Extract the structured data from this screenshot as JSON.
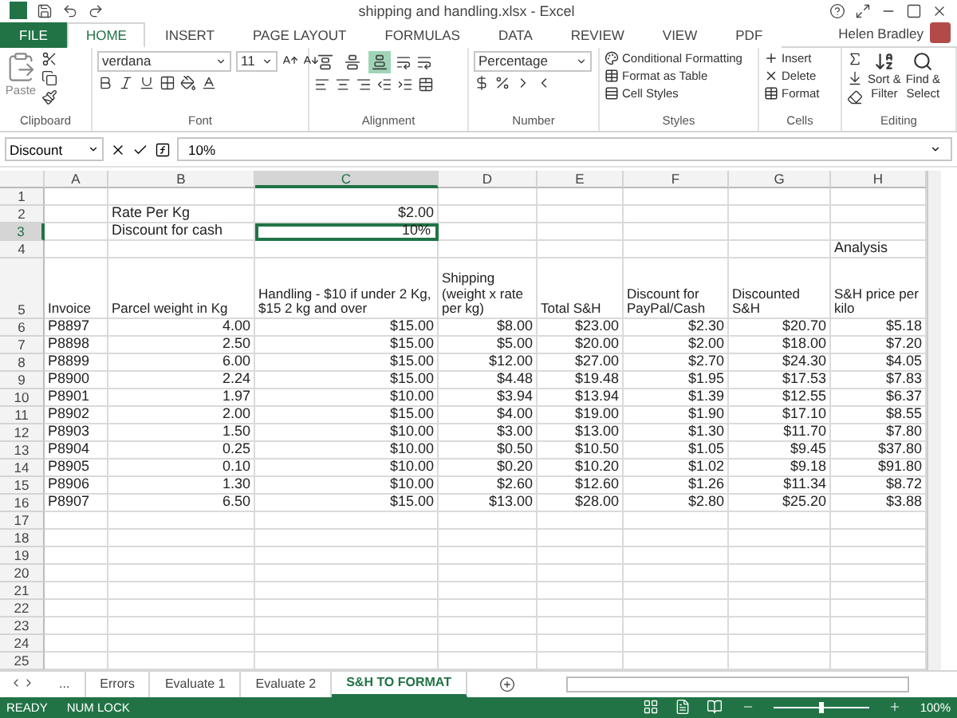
{
  "window": {
    "title": "shipping and handling.xlsx - Excel"
  },
  "ribbon_tabs": [
    {
      "label": "FILE",
      "kind": "file",
      "selected": false
    },
    {
      "label": "HOME",
      "kind": "tab",
      "selected": true
    },
    {
      "label": "INSERT",
      "kind": "tab",
      "selected": false
    },
    {
      "label": "PAGE LAYOUT",
      "kind": "tab",
      "selected": false
    },
    {
      "label": "FORMULAS",
      "kind": "tab",
      "selected": false
    },
    {
      "label": "DATA",
      "kind": "tab",
      "selected": false
    },
    {
      "label": "REVIEW",
      "kind": "tab",
      "selected": false
    },
    {
      "label": "VIEW",
      "kind": "tab",
      "selected": false
    },
    {
      "label": "PDF",
      "kind": "tab",
      "selected": false
    }
  ],
  "user": "Helen Bradley",
  "clipboard": {
    "label": "Clipboard",
    "paste": "Paste"
  },
  "font": {
    "label": "Font",
    "name": "verdana",
    "size": "11"
  },
  "alignment": {
    "label": "Alignment",
    "vertical": [
      {
        "kind": "top",
        "selected": false
      },
      {
        "kind": "middle",
        "selected": false
      },
      {
        "kind": "bottom",
        "selected": true
      }
    ]
  },
  "number": {
    "label": "Number",
    "format": "Percentage"
  },
  "styles": {
    "label": "Styles",
    "items": [
      "Conditional Formatting",
      "Format as Table",
      "Cell Styles"
    ]
  },
  "cells_group": {
    "label": "Cells",
    "items": [
      "Insert",
      "Delete",
      "Format"
    ]
  },
  "editing": {
    "label": "Editing",
    "items": [
      "Sort &",
      "Filter",
      "Find &",
      "Select"
    ]
  },
  "formula_bar": {
    "name_box": "Discount",
    "value": "10%"
  },
  "columns": [
    {
      "label": "A",
      "selected": false
    },
    {
      "label": "B",
      "selected": false
    },
    {
      "label": "C",
      "selected": true
    },
    {
      "label": "D",
      "selected": false
    },
    {
      "label": "E",
      "selected": false
    },
    {
      "label": "F",
      "selected": false
    },
    {
      "label": "G",
      "selected": false
    },
    {
      "label": "H",
      "selected": false
    }
  ],
  "rows": [
    {
      "header": "1",
      "selected": false,
      "cells": {}
    },
    {
      "header": "2",
      "selected": false,
      "cells": {
        "B": "Rate Per Kg",
        "C": "$2.00"
      }
    },
    {
      "header": "3",
      "selected": true,
      "cells": {
        "B": "Discount for cash",
        "C": "10%"
      }
    },
    {
      "header": "4",
      "selected": false,
      "cells": {
        "H": "Analysis"
      }
    },
    {
      "header": "5",
      "selected": false,
      "tall": true,
      "cells": {
        "A": "Invoice",
        "B": "Parcel weight in Kg",
        "C": "Handling - $10 if under 2 Kg, $15 2 kg and over",
        "D": "Shipping (weight x rate per kg)",
        "E": "Total S&H",
        "F": "Discount for PayPal/Cash",
        "G": "Discounted S&H",
        "H": "S&H price per kilo"
      }
    },
    {
      "header": "6",
      "selected": false,
      "cells": {
        "A": "P8897",
        "B": "4.00",
        "C": "$15.00",
        "D": "$8.00",
        "E": "$23.00",
        "F": "$2.30",
        "G": "$20.70",
        "H": "$5.18"
      }
    },
    {
      "header": "7",
      "selected": false,
      "cells": {
        "A": "P8898",
        "B": "2.50",
        "C": "$15.00",
        "D": "$5.00",
        "E": "$20.00",
        "F": "$2.00",
        "G": "$18.00",
        "H": "$7.20"
      }
    },
    {
      "header": "8",
      "selected": false,
      "cells": {
        "A": "P8899",
        "B": "6.00",
        "C": "$15.00",
        "D": "$12.00",
        "E": "$27.00",
        "F": "$2.70",
        "G": "$24.30",
        "H": "$4.05"
      }
    },
    {
      "header": "9",
      "selected": false,
      "cells": {
        "A": "P8900",
        "B": "2.24",
        "C": "$15.00",
        "D": "$4.48",
        "E": "$19.48",
        "F": "$1.95",
        "G": "$17.53",
        "H": "$7.83"
      }
    },
    {
      "header": "10",
      "selected": false,
      "cells": {
        "A": "P8901",
        "B": "1.97",
        "C": "$10.00",
        "D": "$3.94",
        "E": "$13.94",
        "F": "$1.39",
        "G": "$12.55",
        "H": "$6.37"
      }
    },
    {
      "header": "11",
      "selected": false,
      "cells": {
        "A": "P8902",
        "B": "2.00",
        "C": "$15.00",
        "D": "$4.00",
        "E": "$19.00",
        "F": "$1.90",
        "G": "$17.10",
        "H": "$8.55"
      }
    },
    {
      "header": "12",
      "selected": false,
      "cells": {
        "A": "P8903",
        "B": "1.50",
        "C": "$10.00",
        "D": "$3.00",
        "E": "$13.00",
        "F": "$1.30",
        "G": "$11.70",
        "H": "$7.80"
      }
    },
    {
      "header": "13",
      "selected": false,
      "cells": {
        "A": "P8904",
        "B": "0.25",
        "C": "$10.00",
        "D": "$0.50",
        "E": "$10.50",
        "F": "$1.05",
        "G": "$9.45",
        "H": "$37.80"
      }
    },
    {
      "header": "14",
      "selected": false,
      "cells": {
        "A": "P8905",
        "B": "0.10",
        "C": "$10.00",
        "D": "$0.20",
        "E": "$10.20",
        "F": "$1.02",
        "G": "$9.18",
        "H": "$91.80"
      }
    },
    {
      "header": "15",
      "selected": false,
      "cells": {
        "A": "P8906",
        "B": "1.30",
        "C": "$10.00",
        "D": "$2.60",
        "E": "$12.60",
        "F": "$1.26",
        "G": "$11.34",
        "H": "$8.72"
      }
    },
    {
      "header": "16",
      "selected": false,
      "cells": {
        "A": "P8907",
        "B": "6.50",
        "C": "$15.00",
        "D": "$13.00",
        "E": "$28.00",
        "F": "$2.80",
        "G": "$25.20",
        "H": "$3.88"
      }
    },
    {
      "header": "17",
      "selected": false,
      "cells": {}
    },
    {
      "header": "18",
      "selected": false,
      "cells": {}
    },
    {
      "header": "19",
      "selected": false,
      "cells": {}
    },
    {
      "header": "20",
      "selected": false,
      "cells": {}
    },
    {
      "header": "21",
      "selected": false,
      "cells": {}
    },
    {
      "header": "22",
      "selected": false,
      "cells": {}
    },
    {
      "header": "23",
      "selected": false,
      "cells": {}
    },
    {
      "header": "24",
      "selected": false,
      "cells": {}
    },
    {
      "header": "25",
      "selected": false,
      "cells": {}
    }
  ],
  "sheet_tabs": {
    "more": "...",
    "tabs": [
      {
        "label": "Errors",
        "selected": false
      },
      {
        "label": "Evaluate 1",
        "selected": false
      },
      {
        "label": "Evaluate 2",
        "selected": false
      },
      {
        "label": "S&H TO FORMAT",
        "selected": true
      }
    ]
  },
  "status_bar": {
    "mode": "READY",
    "num_lock": "NUM LOCK",
    "zoom_slider": {
      "level": 0.5
    },
    "zoom": "100%"
  }
}
